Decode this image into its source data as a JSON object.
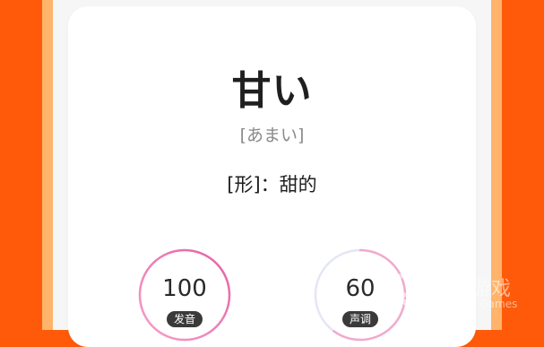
{
  "word": "甘い",
  "reading": "[あまい]",
  "meaning": "[形]：甜的",
  "scores": [
    {
      "value": "100",
      "label": "发音",
      "progress": 1.0
    },
    {
      "value": "60",
      "label": "声调",
      "progress": 0.6
    }
  ],
  "watermark": {
    "title": "仍玩游戏",
    "subtitle": "Renwan Games",
    "logo": "rw-logo-icon"
  },
  "colors": {
    "background": "#ff5a0a",
    "accent_strip": "#ffb36b",
    "gauge_pink": "#f06fb0",
    "gauge_lavender": "#d6d2ee"
  }
}
